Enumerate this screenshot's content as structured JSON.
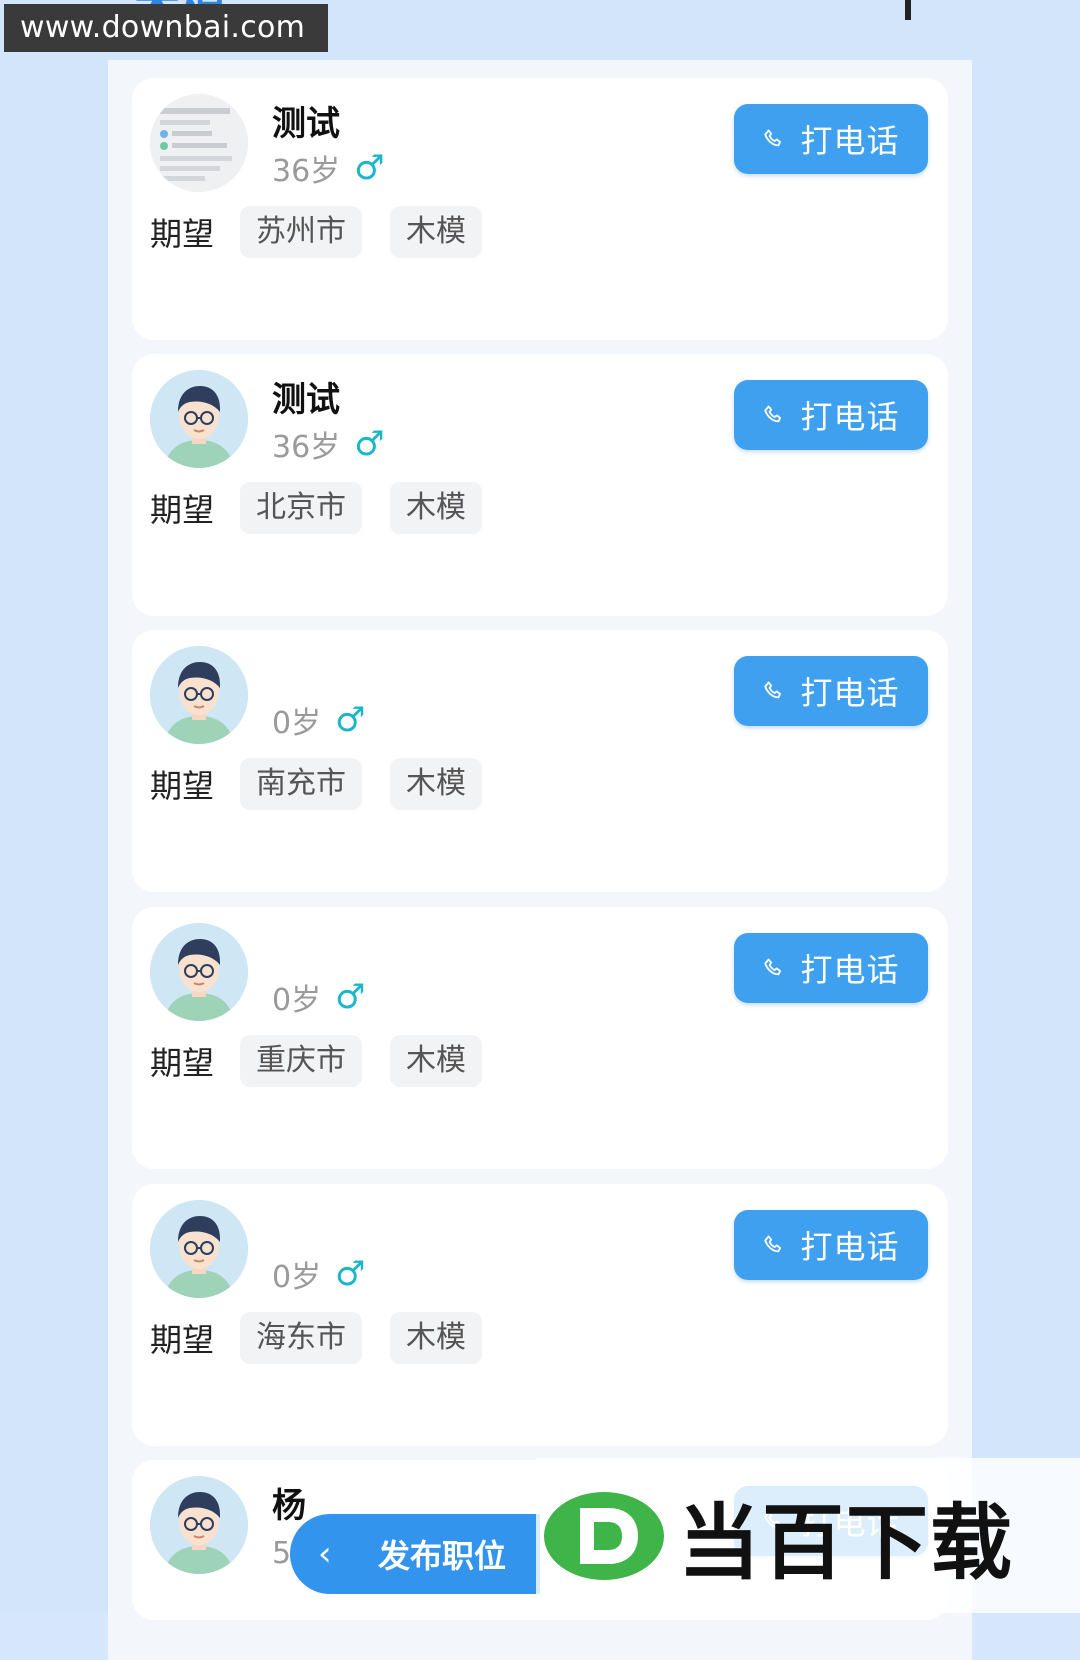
{
  "watermark_top": "www.downbai.com",
  "watermark_bottom": "当百下载",
  "header": {
    "title_partial": "木模"
  },
  "call_label": "打电话",
  "expect_label": "期望",
  "publish_label": "发布职位",
  "candidates": [
    {
      "name": "测试",
      "age": "36岁",
      "gender_symbol": "♂",
      "city": "苏州市",
      "job": "木模",
      "avatar": "screenshot-photo"
    },
    {
      "name": "测试",
      "age": "36岁",
      "gender_symbol": "♂",
      "city": "北京市",
      "job": "木模",
      "avatar": "default-male-avatar"
    },
    {
      "name": "",
      "age": "0岁",
      "gender_symbol": "♂",
      "city": "南充市",
      "job": "木模",
      "avatar": "default-male-avatar"
    },
    {
      "name": "",
      "age": "0岁",
      "gender_symbol": "♂",
      "city": "重庆市",
      "job": "木模",
      "avatar": "default-male-avatar"
    },
    {
      "name": "",
      "age": "0岁",
      "gender_symbol": "♂",
      "city": "海东市",
      "job": "木模",
      "avatar": "default-male-avatar"
    },
    {
      "name": "杨",
      "age": "58岁",
      "gender_symbol": "♂",
      "city": "",
      "job": "",
      "avatar": "default-male-avatar"
    }
  ],
  "colors": {
    "page_bg": "#d3e5fb",
    "panel_bg": "#f3f7fc",
    "card_bg": "#ffffff",
    "call_button": "#3ea0ee",
    "gender_male": "#19b7c9",
    "tag_bg": "#f2f3f5",
    "publish_button": "#3394ee"
  }
}
